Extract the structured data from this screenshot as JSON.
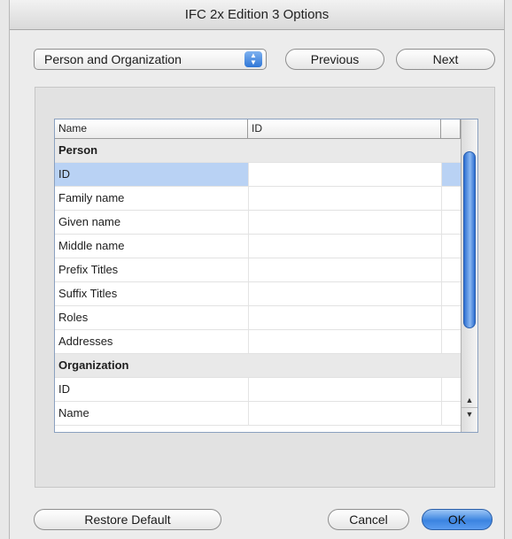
{
  "window": {
    "title": "IFC 2x Edition 3 Options"
  },
  "toolbar": {
    "category_select": "Person and Organization",
    "previous_label": "Previous",
    "next_label": "Next"
  },
  "table": {
    "columns": [
      "Name",
      "ID",
      ""
    ],
    "rows": [
      {
        "name": "Person",
        "id": "",
        "type": "group"
      },
      {
        "name": "ID",
        "id": "",
        "type": "selected"
      },
      {
        "name": "Family name",
        "id": "",
        "type": "item"
      },
      {
        "name": "Given name",
        "id": "",
        "type": "item"
      },
      {
        "name": "Middle name",
        "id": "",
        "type": "item"
      },
      {
        "name": "Prefix Titles",
        "id": "",
        "type": "item"
      },
      {
        "name": "Suffix Titles",
        "id": "",
        "type": "item"
      },
      {
        "name": "Roles",
        "id": "",
        "type": "item"
      },
      {
        "name": "Addresses",
        "id": "",
        "type": "item"
      },
      {
        "name": "Organization",
        "id": "",
        "type": "group"
      },
      {
        "name": "ID",
        "id": "",
        "type": "item"
      },
      {
        "name": "Name",
        "id": "",
        "type": "item"
      }
    ]
  },
  "footer": {
    "restore_label": "Restore Default",
    "cancel_label": "Cancel",
    "ok_label": "OK"
  },
  "icons": {
    "popup_arrows": "up-down-chevron-icon",
    "scroll_up": "scroll-up-arrow-icon",
    "scroll_down": "scroll-down-arrow-icon"
  },
  "colors": {
    "selection": "#b9d2f4",
    "accent": "#3b84e0"
  }
}
